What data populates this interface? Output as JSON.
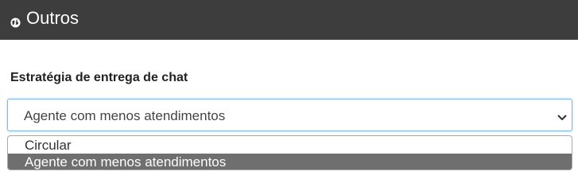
{
  "header": {
    "icon": "globe-icon",
    "title": "Outros",
    "background": "#3d3d3d"
  },
  "field": {
    "label": "Estratégia de entrega de chat",
    "selected_value": "Agente com menos atendimentos",
    "chevron_icon": "chevron-down-icon",
    "options": [
      {
        "label": "Circular",
        "highlighted": false
      },
      {
        "label": "Agente com menos atendimentos",
        "highlighted": true
      }
    ],
    "highlight_color": "#6f6f6f",
    "focus_border_color": "#7fb5e6"
  }
}
